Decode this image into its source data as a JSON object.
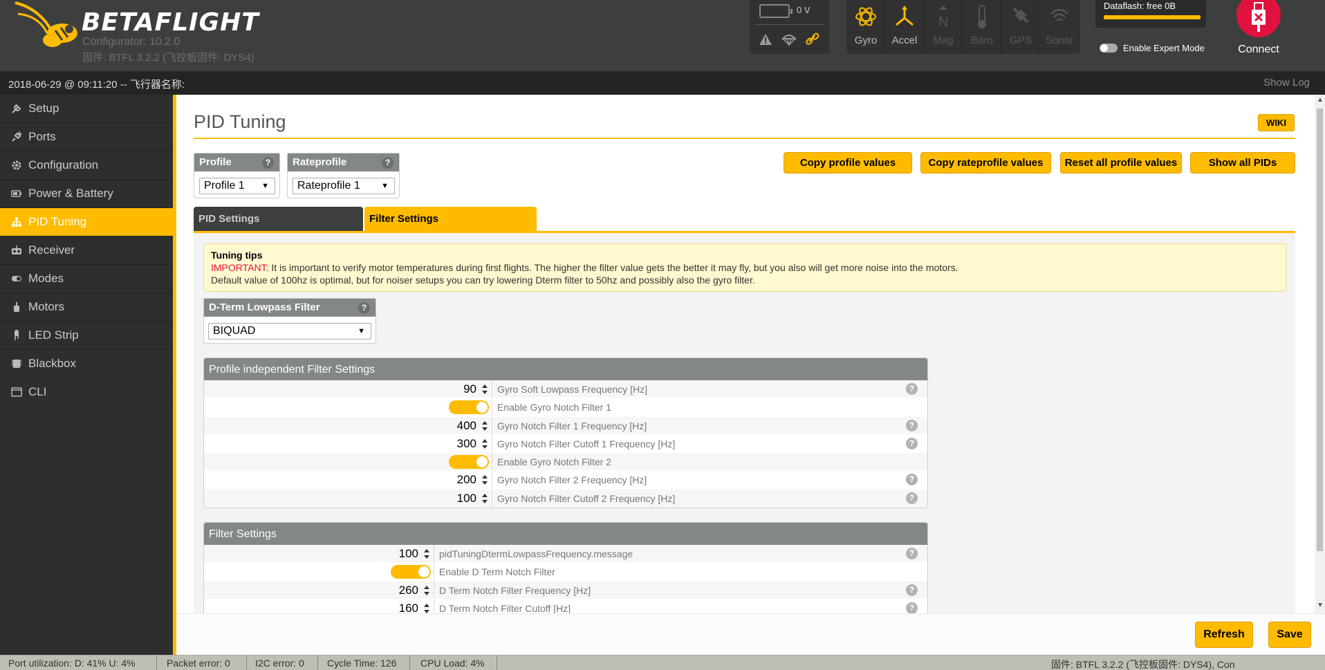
{
  "header": {
    "brand": "BETAFLIGHT",
    "configurator_version": "Configurator: 10.2.0",
    "firmware_line": "固件: BTFL 3.2.2 (飞控板固件: DYS4)",
    "battery_voltage": "0 V",
    "sensors": [
      {
        "label": "Gyro",
        "icon": "gyro-icon",
        "active": true
      },
      {
        "label": "Accel",
        "icon": "accel-icon",
        "active": true
      },
      {
        "label": "Mag",
        "icon": "mag-icon",
        "active": false
      },
      {
        "label": "Baro",
        "icon": "baro-icon",
        "active": false
      },
      {
        "label": "GPS",
        "icon": "gps-icon",
        "active": false
      },
      {
        "label": "Sonar",
        "icon": "sonar-icon",
        "active": false
      }
    ],
    "dataflash": "Dataflash: free 0B",
    "expert_mode_label": "Enable Expert Mode",
    "connect_label": "Connect"
  },
  "logbar": {
    "text": "2018-06-29 @ 09:11:20 -- 飞行器名称:",
    "show_log": "Show Log"
  },
  "sidebar": {
    "items": [
      {
        "label": "Setup",
        "icon": "wrench-icon"
      },
      {
        "label": "Ports",
        "icon": "plug-icon"
      },
      {
        "label": "Configuration",
        "icon": "gear-icon"
      },
      {
        "label": "Power & Battery",
        "icon": "battery-icon"
      },
      {
        "label": "PID Tuning",
        "icon": "sitemap-icon"
      },
      {
        "label": "Receiver",
        "icon": "receiver-icon"
      },
      {
        "label": "Modes",
        "icon": "modes-icon"
      },
      {
        "label": "Motors",
        "icon": "motor-icon"
      },
      {
        "label": "LED Strip",
        "icon": "led-icon"
      },
      {
        "label": "Blackbox",
        "icon": "blackbox-icon"
      },
      {
        "label": "CLI",
        "icon": "cli-icon"
      }
    ],
    "active": "PID Tuning"
  },
  "main": {
    "title": "PID Tuning",
    "wiki": "WIKI",
    "profile": {
      "label": "Profile",
      "value": "Profile 1"
    },
    "rateprofile": {
      "label": "Rateprofile",
      "value": "Rateprofile 1"
    },
    "actions": {
      "copy_profile": "Copy profile values",
      "copy_rateprofile": "Copy rateprofile values",
      "reset_all": "Reset all profile values",
      "show_all": "Show all PIDs"
    },
    "tabs": {
      "pid": "PID Settings",
      "filter": "Filter Settings"
    },
    "tips": {
      "title": "Tuning tips",
      "important": "IMPORTANT:",
      "line1": " It is important to verify motor temperatures during first flights. The higher the filter value gets the better it may fly, but you also will get more noise into the motors.",
      "line2": "Default value of 100hz is optimal, but for noiser setups you can try lowering Dterm filter to 50hz and possibly also the gyro filter."
    },
    "dterm": {
      "label": "D-Term Lowpass Filter",
      "value": "BIQUAD"
    },
    "profile_independent": {
      "title": "Profile independent Filter Settings",
      "rows": [
        {
          "value": "90",
          "label": "Gyro Soft Lowpass Frequency [Hz]",
          "toggle": false,
          "help": true
        },
        {
          "value": "",
          "label": "Enable Gyro Notch Filter 1",
          "toggle": true,
          "help": false
        },
        {
          "value": "400",
          "label": "Gyro Notch Filter 1 Frequency [Hz]",
          "toggle": false,
          "help": true
        },
        {
          "value": "300",
          "label": "Gyro Notch Filter Cutoff 1 Frequency [Hz]",
          "toggle": false,
          "help": true
        },
        {
          "value": "",
          "label": "Enable Gyro Notch Filter 2",
          "toggle": true,
          "help": false
        },
        {
          "value": "200",
          "label": "Gyro Notch Filter 2 Frequency [Hz]",
          "toggle": false,
          "help": true
        },
        {
          "value": "100",
          "label": "Gyro Notch Filter Cutoff 2 Frequency [Hz]",
          "toggle": false,
          "help": true
        }
      ]
    },
    "filter_settings": {
      "title": "Filter Settings",
      "rows": [
        {
          "value": "100",
          "label": "pidTuningDtermLowpassFrequency.message",
          "toggle": false,
          "help": true
        },
        {
          "value": "",
          "label": "Enable D Term Notch Filter",
          "toggle": true,
          "help": false
        },
        {
          "value": "260",
          "label": "D Term Notch Filter Frequency [Hz]",
          "toggle": false,
          "help": true
        },
        {
          "value": "160",
          "label": "D Term Notch Filter Cutoff [Hz]",
          "toggle": false,
          "help": true
        }
      ]
    }
  },
  "bottom": {
    "refresh": "Refresh",
    "save": "Save"
  },
  "status": {
    "port": "Port utilization: D: 41% U: 4%",
    "packet": "Packet error: 0",
    "i2c": "I2C error: 0",
    "cycle": "Cycle Time: 126",
    "cpu": "CPU Load: 4%",
    "firmware": "固件: BTFL 3.2.2 (飞控板固件: DYS4), Con"
  },
  "colors": {
    "accent": "#ffbb00",
    "connect": "#e2123f",
    "sidebar": "#2e2e2e",
    "header": "#3d3f3e"
  }
}
